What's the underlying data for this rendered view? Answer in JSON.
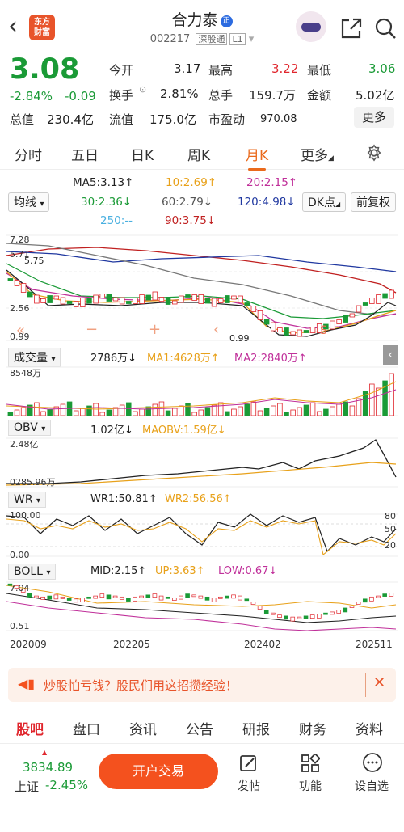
{
  "header": {
    "logo_text": "东方财富",
    "stock_name": "合力泰",
    "name_badge": "正",
    "stock_code": "002217",
    "market": "深股通",
    "level": "L1"
  },
  "quote": {
    "price": "3.08",
    "change_pct": "-2.84%",
    "change": "-0.09",
    "fields": [
      {
        "k": "今开",
        "v": "3.17"
      },
      {
        "k": "最高",
        "v": "3.22"
      },
      {
        "k": "最低",
        "v": "3.06"
      },
      {
        "k": "换手",
        "v": "2.81%"
      },
      {
        "k": "总手",
        "v": "159.7万"
      },
      {
        "k": "金额",
        "v": "5.02亿"
      },
      {
        "k": "总值",
        "v": "230.4亿"
      },
      {
        "k": "流值",
        "v": "175.0亿"
      },
      {
        "k": "市盈动",
        "v": "970.08"
      }
    ],
    "more_label": "更多"
  },
  "period_tabs": [
    "分时",
    "五日",
    "日K",
    "周K",
    "月K",
    "更多"
  ],
  "active_tab": "月K",
  "ma": {
    "ma5": "MA5:3.13↑",
    "ma10": "10:2.69↑",
    "ma20": "20:2.15↑",
    "ma30": "30:2.36↓",
    "ma60": "60:2.79↓",
    "ma120": "120:4.98↓",
    "ma250": "250:--",
    "ma90": "90:3.75↓"
  },
  "controls": {
    "indicator": "均线",
    "dk": "DK点",
    "adjust": "前复权"
  },
  "kline": {
    "y_labels": [
      "7.28",
      "5.71",
      "5.75",
      "2.56",
      "0.99"
    ],
    "min_mark": "0.99"
  },
  "volume": {
    "label": "成交量",
    "value": "2786万↓",
    "ma1": "MA1:4628万↑",
    "ma2": "MA2:2840万↑",
    "max": "8548万"
  },
  "obv": {
    "label": "OBV",
    "value": "1.02亿↓",
    "maobv": "MAOBV:1.59亿↓",
    "top": "2.48亿",
    "bottom": "0285.96万"
  },
  "wr": {
    "label": "WR",
    "wr1": "WR1:50.81↑",
    "wr2": "WR2:56.56↑",
    "top": "100.00",
    "bottom": "0.00",
    "r80": "80",
    "r50": "50",
    "r20": "20"
  },
  "boll": {
    "label": "BOLL",
    "mid": "MID:2.15↑",
    "up": "UP:3.63↑",
    "low": "LOW:0.67↓",
    "top": "7.04",
    "bottom": "0.51"
  },
  "x_axis": [
    "202009",
    "202205",
    "202402",
    "202511"
  ],
  "banner": {
    "text": "炒股怕亏钱？股民们用这招攒经验！"
  },
  "bottom_tabs": [
    "股吧",
    "盘口",
    "资讯",
    "公告",
    "研报",
    "财务",
    "资料"
  ],
  "index": {
    "value": "3834.89",
    "name": "上证",
    "change": "-2.45%"
  },
  "footer": {
    "trade": "开户交易",
    "post": "发帖",
    "func": "功能",
    "custom": "设自选"
  },
  "colors": {
    "up": "#e0262d",
    "down": "#1a9a36",
    "accent": "#ea6a1c"
  }
}
